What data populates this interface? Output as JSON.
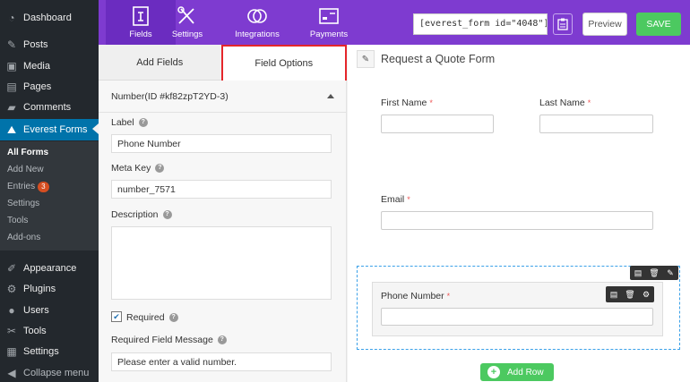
{
  "sidebar": {
    "items": [
      {
        "label": "Dashboard",
        "icon": "dashboard-icon"
      },
      {
        "label": "Posts",
        "icon": "pin-icon"
      },
      {
        "label": "Media",
        "icon": "media-icon"
      },
      {
        "label": "Pages",
        "icon": "pages-icon"
      },
      {
        "label": "Comments",
        "icon": "comments-icon"
      },
      {
        "label": "Everest Forms",
        "icon": "everest-forms-icon"
      }
    ],
    "submenu": [
      {
        "label": "All Forms"
      },
      {
        "label": "Add New"
      },
      {
        "label": "Entries",
        "badge": "3"
      },
      {
        "label": "Settings"
      },
      {
        "label": "Tools"
      },
      {
        "label": "Add-ons"
      }
    ],
    "lower_items": [
      {
        "label": "Appearance",
        "icon": "appearance-icon"
      },
      {
        "label": "Plugins",
        "icon": "plugins-icon"
      },
      {
        "label": "Users",
        "icon": "users-icon"
      },
      {
        "label": "Tools",
        "icon": "tools-icon"
      },
      {
        "label": "Settings",
        "icon": "settings-icon"
      },
      {
        "label": "Collapse menu",
        "icon": "collapse-icon"
      }
    ]
  },
  "topnav": {
    "tabs": [
      {
        "label": "Fields",
        "icon": "fields-icon"
      },
      {
        "label": "Settings",
        "icon": "settings-tools-icon"
      },
      {
        "label": "Integrations",
        "icon": "integrations-icon"
      },
      {
        "label": "Payments",
        "icon": "payments-icon"
      }
    ],
    "shortcode": "[everest_form id=\"4048\"]",
    "preview_label": "Preview",
    "save_label": "SAVE",
    "accent": "#7e3bd0",
    "save_color": "#4cc960"
  },
  "panel": {
    "tabs": [
      "Add Fields",
      "Field Options"
    ],
    "field_header": "Number(ID #kf82zpT2YD-3)",
    "label_label": "Label",
    "label_value": "Phone Number",
    "metakey_label": "Meta Key",
    "metakey_value": "number_7571",
    "description_label": "Description",
    "required_label": "Required",
    "required_checked": true,
    "required_msg_label": "Required Field Message",
    "required_msg_value": "Please enter a valid number."
  },
  "form": {
    "title": "Request a Quote Form",
    "first_name": "First Name",
    "last_name": "Last Name",
    "email": "Email",
    "phone": "Phone Number",
    "add_row": "Add Row",
    "required_mark": "*"
  }
}
